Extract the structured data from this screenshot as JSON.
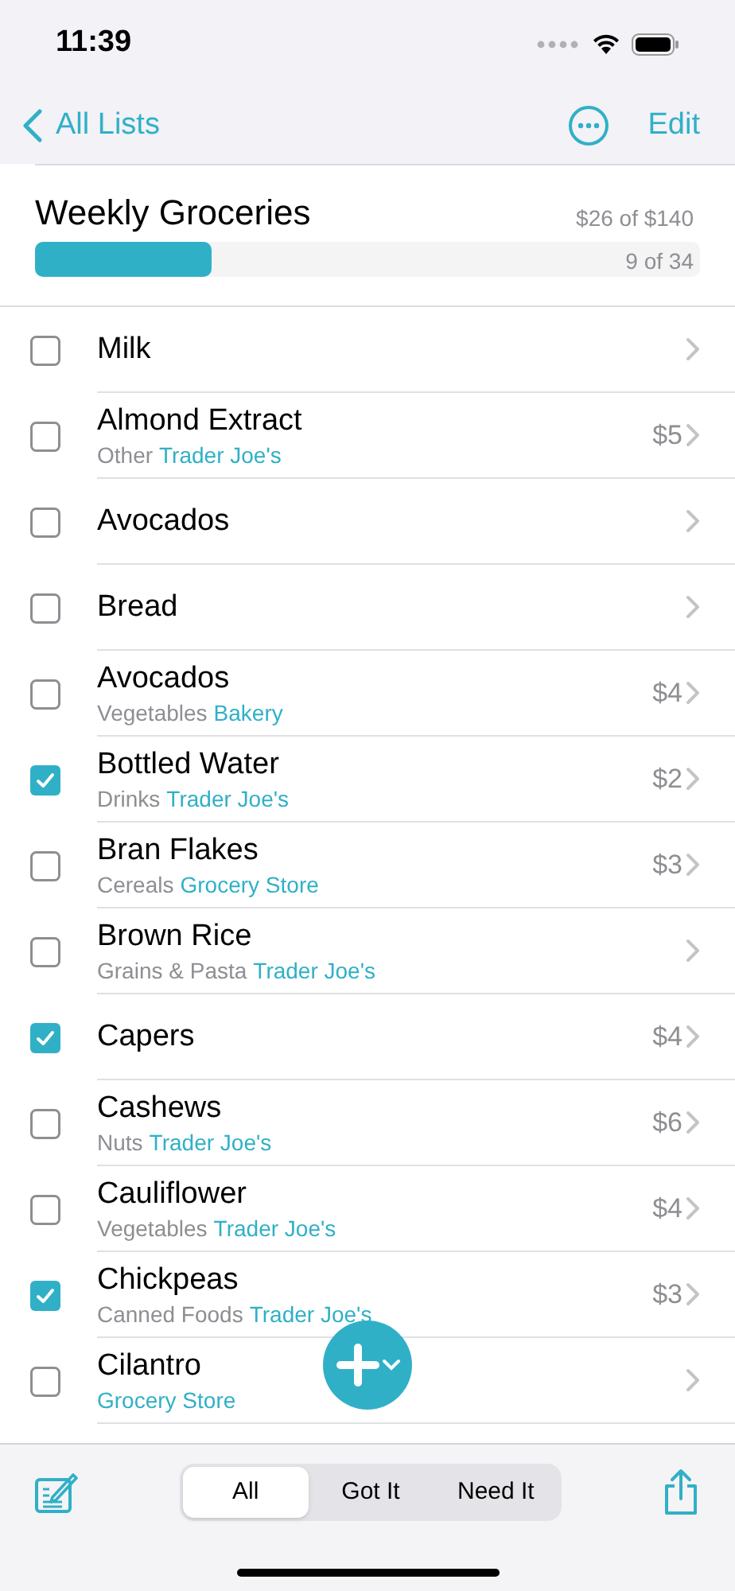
{
  "status_bar": {
    "time": "11:39"
  },
  "nav": {
    "back": "All Lists",
    "action": "Edit"
  },
  "list": {
    "title": "Weekly Groceries",
    "total": "$26 of $140",
    "count": "9 of 34",
    "level": 0.265
  },
  "items": [
    {
      "name": "Milk",
      "checked": false
    },
    {
      "name": "Almond Extract",
      "category": "Other",
      "store": "Trader Joe's",
      "price": "$5",
      "checked": false
    },
    {
      "name": "Avocados",
      "checked": false
    },
    {
      "name": "Bread",
      "checked": false
    },
    {
      "name": "Avocados",
      "category": "Vegetables",
      "store": "Bakery",
      "price": "$4",
      "checked": false
    },
    {
      "name": "Bottled Water",
      "category": "Drinks",
      "store": "Trader Joe's",
      "price": "$2",
      "checked": true
    },
    {
      "name": "Bran Flakes",
      "category": "Cereals",
      "store": "Grocery Store",
      "price": "$3",
      "checked": false
    },
    {
      "name": "Brown Rice",
      "category": "Grains & Pasta",
      "store": "Trader Joe's",
      "checked": false
    },
    {
      "name": "Capers",
      "price": "$4",
      "checked": true
    },
    {
      "name": "Cashews",
      "category": "Nuts",
      "store": "Trader Joe's",
      "price": "$6",
      "checked": false
    },
    {
      "name": "Cauliflower",
      "category": "Vegetables",
      "store": "Trader Joe's",
      "price": "$4",
      "checked": false
    },
    {
      "name": "Chickpeas",
      "category": "Canned Foods",
      "store": "Trader Joe's",
      "price": "$3",
      "checked": true
    },
    {
      "name": "Cilantro",
      "store": "Grocery Store",
      "checked": false
    }
  ],
  "filter_tabs": [
    {
      "label": "All",
      "selected": true
    },
    {
      "label": "Got It",
      "selected": false
    },
    {
      "label": "Need It",
      "selected": false
    }
  ]
}
